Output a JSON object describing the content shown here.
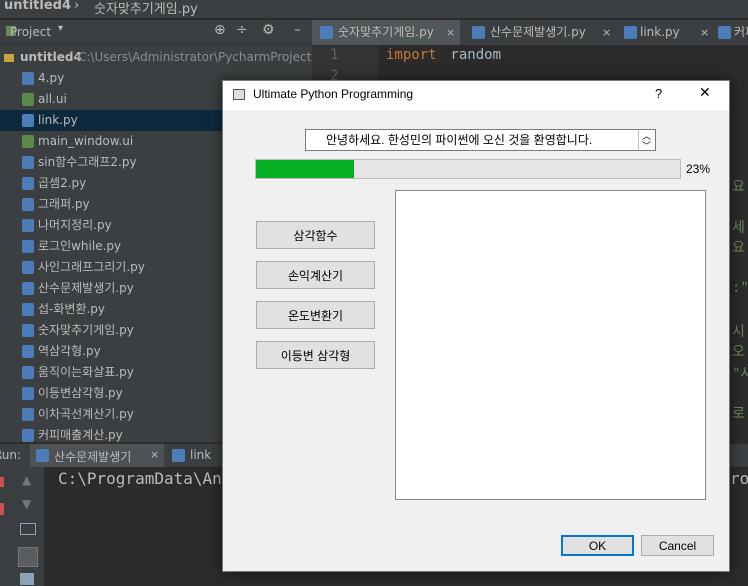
{
  "ide": {
    "title_items": [
      "untitled4",
      "숫자맞추기게임.py"
    ],
    "project_label": "Project",
    "root": {
      "name": "untitled4",
      "path": "C:\\Users\\Administrator\\PycharmProjects"
    },
    "files": [
      {
        "name": "4.py",
        "kind": "py"
      },
      {
        "name": "all.ui",
        "kind": "ui"
      },
      {
        "name": "link.py",
        "kind": "py"
      },
      {
        "name": "main_window.ui",
        "kind": "ui"
      },
      {
        "name": "sin함수그래프2.py",
        "kind": "py"
      },
      {
        "name": "곱셈2.py",
        "kind": "py"
      },
      {
        "name": "그래퍼.py",
        "kind": "py"
      },
      {
        "name": "나머지정리.py",
        "kind": "py"
      },
      {
        "name": "로그인while.py",
        "kind": "py"
      },
      {
        "name": "사인그래프그리기.py",
        "kind": "py"
      },
      {
        "name": "산수문제발생기.py",
        "kind": "py"
      },
      {
        "name": "섭-화변환.py",
        "kind": "py"
      },
      {
        "name": "숫자맞추기게임.py",
        "kind": "py"
      },
      {
        "name": "역삼각형.py",
        "kind": "py"
      },
      {
        "name": "움직이는화살표.py",
        "kind": "py"
      },
      {
        "name": "이등변삼각형.py",
        "kind": "py"
      },
      {
        "name": "이차곡선계산기.py",
        "kind": "py"
      },
      {
        "name": "커피매출계산.py",
        "kind": "py"
      }
    ],
    "selected_file": "link.py",
    "editor_tabs": [
      "숫자맞추기게임.py",
      "산수문제발생기.py",
      "link.py",
      "커피"
    ],
    "line_numbers": [
      "1",
      "2"
    ],
    "code_keyword": "import",
    "code_rest": " random",
    "edge_fragments": [
      "요.",
      "세요",
      ":\"",
      "시오",
      "\"사",
      "로"
    ],
    "run_label": "Run:",
    "run_tabs": [
      "산수문제발생기",
      "link"
    ],
    "console_text": "C:\\ProgramData\\An",
    "console_tail": "ro"
  },
  "dialog": {
    "title": "Ultimate Python Programming",
    "help": "?",
    "close": "✕",
    "welcome": "안녕하세요. 한성민의 파이썬에 오신 것을 환영합니다.",
    "progress_value": 23,
    "progress_text": "23%",
    "buttons": [
      "삼각함수",
      "손익계산기",
      "온도변환기",
      "이등변 삼각형"
    ],
    "ok": "OK",
    "cancel": "Cancel"
  }
}
